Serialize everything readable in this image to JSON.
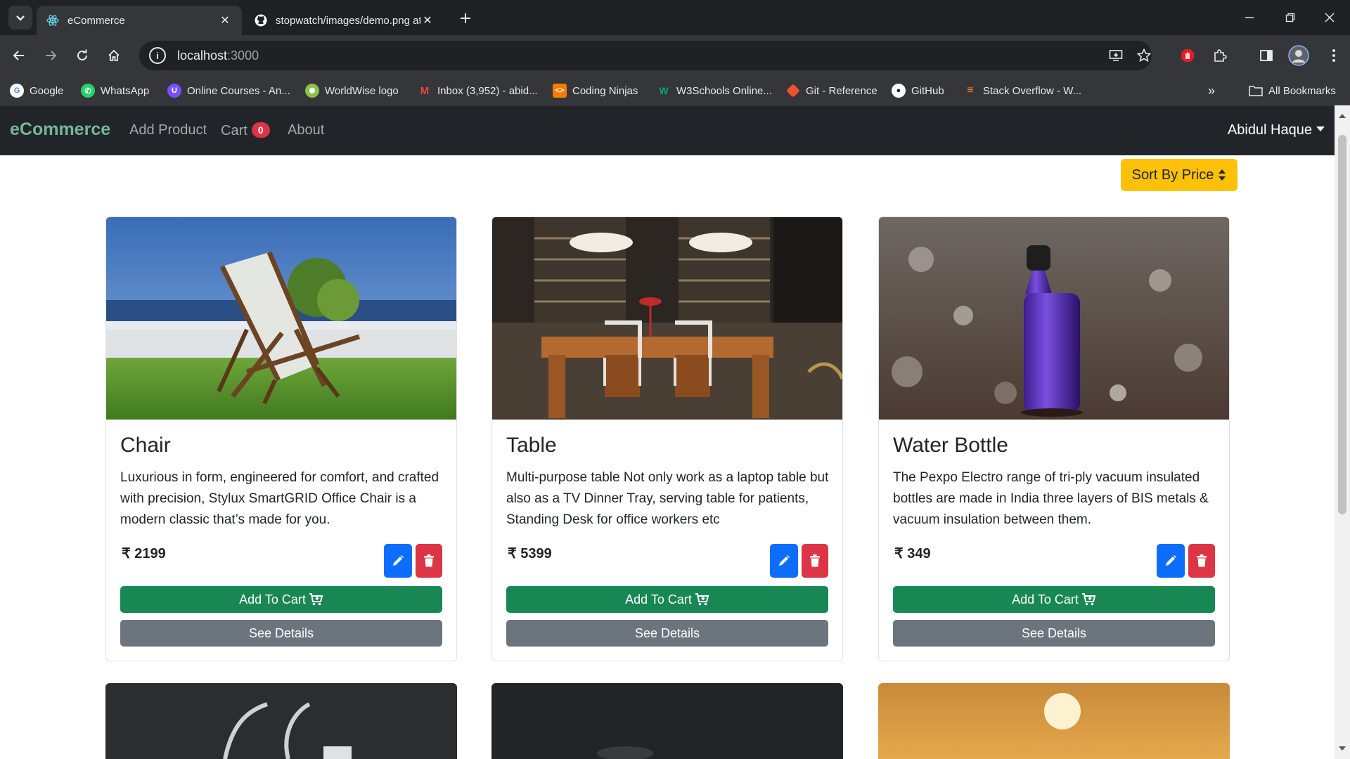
{
  "browser": {
    "tabs": [
      {
        "title": "eCommerce",
        "active": true,
        "icon": "react-icon"
      },
      {
        "title": "stopwatch/images/demo.png at",
        "active": false,
        "icon": "github-icon"
      }
    ],
    "address": {
      "host": "localhost",
      "port": ":3000"
    },
    "bookmarks": [
      {
        "label": "Google",
        "icon": "google-icon",
        "color": "#4285f4"
      },
      {
        "label": "WhatsApp",
        "icon": "whatsapp-icon",
        "color": "#25d366"
      },
      {
        "label": "Online Courses - An...",
        "icon": "courses-icon",
        "color": "#7c4dff"
      },
      {
        "label": "WorldWise logo",
        "icon": "worldwise-icon",
        "color": "#8bc34a"
      },
      {
        "label": "Inbox (3,952) - abid...",
        "icon": "gmail-icon",
        "color": "#ea4335"
      },
      {
        "label": "Coding Ninjas",
        "icon": "codingninjas-icon",
        "color": "#f57c00"
      },
      {
        "label": "W3Schools Online...",
        "icon": "w3schools-icon",
        "color": "#04aa6d"
      },
      {
        "label": "Git - Reference",
        "icon": "git-icon",
        "color": "#f1502f"
      },
      {
        "label": "GitHub",
        "icon": "github-icon",
        "color": "#ffffff"
      },
      {
        "label": "Stack Overflow - W...",
        "icon": "stackoverflow-icon",
        "color": "#f48024"
      }
    ],
    "all_bookmarks": "All Bookmarks"
  },
  "app": {
    "brand": "eCommerce",
    "nav": {
      "add_product": "Add Product",
      "cart": "Cart",
      "cart_count": "0",
      "about": "About"
    },
    "user": "Abidul Haque",
    "sort_label": "Sort By Price",
    "currency": "₹",
    "buttons": {
      "add_to_cart": "Add To Cart",
      "see_details": "See Details"
    },
    "products": [
      {
        "name": "Chair",
        "description": "Luxurious in form, engineered for comfort, and crafted with precision, Stylux SmartGRID Office Chair is a modern classic that’s made for you.",
        "price": "2199"
      },
      {
        "name": "Table",
        "description": "Multi-purpose table Not only work as a laptop table but also as a TV Dinner Tray, serving table for patients, Standing Desk for office workers etc",
        "price": "5399"
      },
      {
        "name": "Water Bottle",
        "description": "The Pexpo Electro range of tri-ply vacuum insulated bottles are made in India three layers of BIS metals & vacuum insulation between them.",
        "price": "349"
      }
    ]
  },
  "colors": {
    "navbar_bg": "#212529",
    "brand": "#75b798",
    "sort_button": "#ffc107",
    "edit_button": "#0d6efd",
    "delete_button": "#dc3545",
    "cart_button": "#198754",
    "details_button": "#6c757d"
  }
}
